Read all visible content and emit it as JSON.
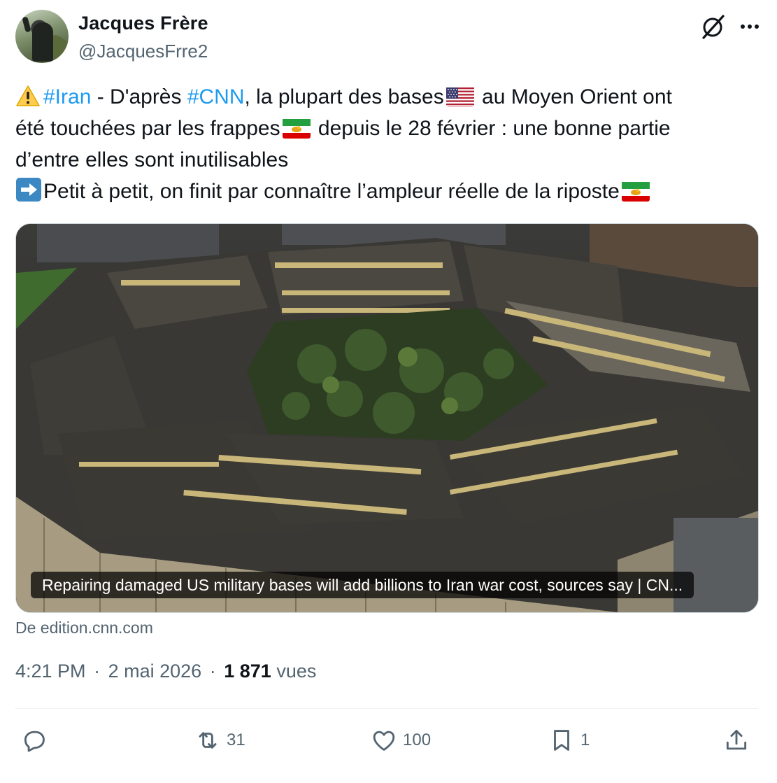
{
  "author": {
    "name": "Jacques Frère",
    "handle": "@JacquesFrre2",
    "avatar": "avatar-photo"
  },
  "header_icons": {
    "grok": "grok-icon",
    "more": "more-options-icon"
  },
  "tweet": {
    "line1": {
      "hashtag_iran": "#Iran",
      "text_a": " - D'après ",
      "hashtag_cnn": "#CNN",
      "text_b": ", la plupart des bases",
      "text_c": " au Moyen Orient ont"
    },
    "line2": {
      "text_a": "été touchées par les frappes",
      "text_b": " depuis le 28 février : une bonne partie"
    },
    "line3": "d’entre elles sont inutilisables",
    "line4": "Petit à petit, on finit par connaître l’ampleur réelle de la riposte"
  },
  "link_card": {
    "caption": "Repairing damaged US military bases will add billions to Iran war cost, sources say | CN...",
    "source": "De edition.cnn.com"
  },
  "meta": {
    "time": "4:21 PM",
    "date": "2 mai 2026",
    "views_count": "1 871",
    "views_label": "vues",
    "separator": "·"
  },
  "actions": {
    "reply": {
      "icon": "reply-icon",
      "count": ""
    },
    "retweet": {
      "icon": "retweet-icon",
      "count": "31"
    },
    "like": {
      "icon": "heart-icon",
      "count": "100"
    },
    "bookmark": {
      "icon": "bookmark-icon",
      "count": "1"
    },
    "share": {
      "icon": "share-icon",
      "count": ""
    }
  },
  "colors": {
    "text": "#0f1419",
    "secondary": "#536471",
    "hashtag": "#1d9bf0",
    "border": "#cfd9de"
  }
}
